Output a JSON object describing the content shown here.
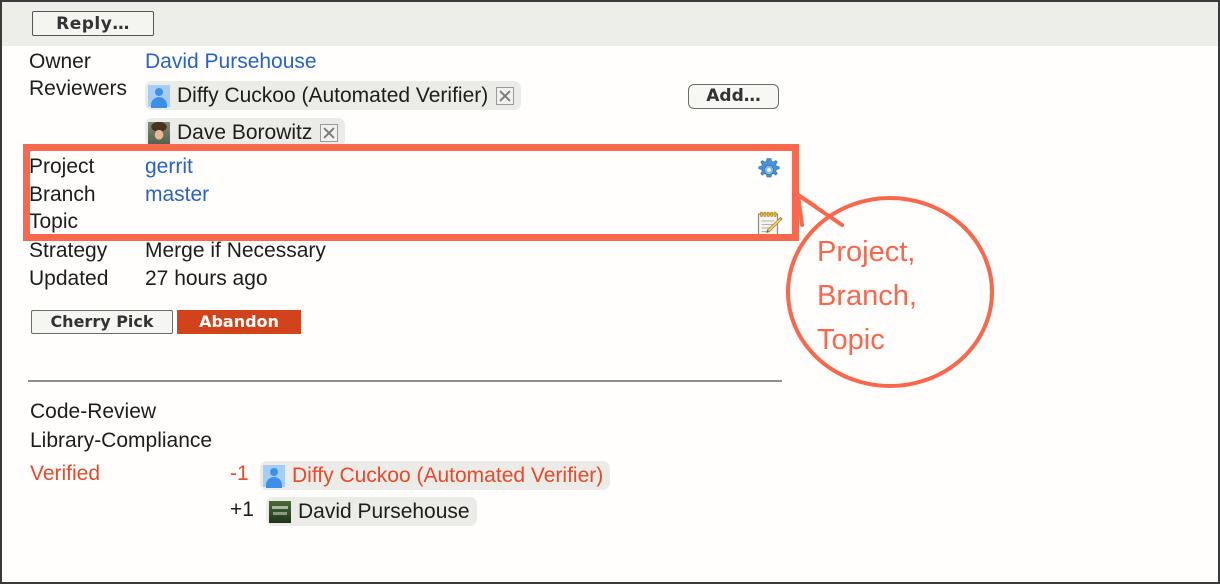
{
  "window": {
    "title": "Gerrit change screen"
  },
  "header": {
    "reply_label": "Reply…"
  },
  "change_info": {
    "rows": [
      {
        "label": "Owner",
        "value": "David Pursehouse",
        "type": "link"
      },
      {
        "label": "Reviewers",
        "value": "",
        "type": "chips"
      },
      {
        "label": "Project",
        "value": "gerrit",
        "type": "link"
      },
      {
        "label": "Branch",
        "value": "master",
        "type": "link"
      },
      {
        "label": "Topic",
        "value": "",
        "type": "link"
      },
      {
        "label": "Strategy",
        "value": "Merge if Necessary",
        "type": "text"
      },
      {
        "label": "Updated",
        "value": "27 hours ago",
        "type": "text"
      }
    ],
    "owner_label": "Owner",
    "owner_value": "David Pursehouse",
    "reviewers_label": "Reviewers",
    "project_label": "Project",
    "project_value": "gerrit",
    "branch_label": "Branch",
    "branch_value": "master",
    "topic_label": "Topic",
    "topic_value": "",
    "strategy_label": "Strategy",
    "strategy_value": "Merge if Necessary",
    "updated_label": "Updated",
    "updated_value": "27 hours ago"
  },
  "reviewers": [
    {
      "name": "Diffy Cuckoo (Automated Verifier)",
      "avatar": "person-placeholder-icon",
      "remove_icon": "remove-x-icon"
    },
    {
      "name": "Dave Borowitz",
      "avatar": "photo-avatar",
      "remove_icon": "remove-x-icon"
    }
  ],
  "add_reviewer": {
    "label": "Add…"
  },
  "row_actions": {
    "project_icon": "gear-icon",
    "topic_icon": "edit-notepad-icon"
  },
  "actions": {
    "cherry_pick_label": "Cherry Pick",
    "abandon_label": "Abandon"
  },
  "labels_section": {
    "rows": [
      {
        "name": "Code-Review",
        "name_color": "#1d1d1d",
        "votes": []
      },
      {
        "name": "Library-Compliance",
        "name_color": "#1d1d1d",
        "votes": []
      },
      {
        "name": "Verified",
        "name_color": "#e8492a",
        "votes": [
          {
            "score": "-1",
            "score_color": "#e8492a",
            "voter": "Diffy Cuckoo (Automated Verifier)",
            "voter_color": "#e8492a",
            "avatar": "person-placeholder-icon"
          },
          {
            "score": "+1",
            "score_color": "#1d1d1d",
            "voter": "David Pursehouse",
            "voter_color": "#1d1d1d",
            "avatar": "photo-avatar"
          }
        ]
      }
    ],
    "code_review_label": "Code-Review",
    "library_compliance_label": "Library-Compliance",
    "verified_label": "Verified",
    "verified_minus_one_score": "-1",
    "verified_minus_one_voter": "Diffy Cuckoo (Automated Verifier)",
    "verified_plus_one_score": "+1",
    "verified_plus_one_voter": "David Pursehouse"
  },
  "annotation": {
    "callout_text": "Project,\nBranch,\nTopic",
    "highlight_color": "#f9674c",
    "highlight_target": "project-branch-topic-rows"
  },
  "colors": {
    "link": "#2a62c4",
    "annotation": "#f9674c",
    "abandon_bg": "#d1441b",
    "header_bg": "#edeee9",
    "verified_red": "#e8492a"
  }
}
